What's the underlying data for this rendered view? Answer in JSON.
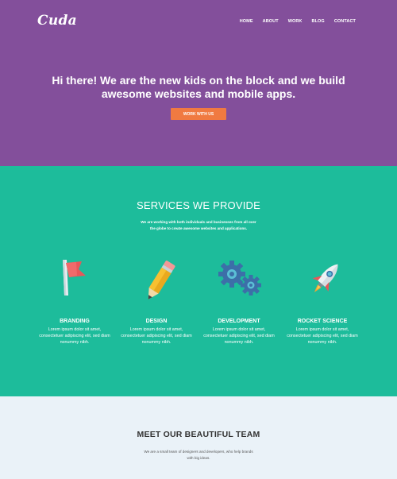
{
  "header": {
    "logo": "Cuda",
    "nav": [
      "HOME",
      "ABOUT",
      "WORK",
      "BLOG",
      "CONTACT"
    ]
  },
  "hero": {
    "headline_line1": "Hi there! We are the new kids on the block and we build",
    "headline_line2": "awesome websites and mobile apps.",
    "cta_label": "WORK WITH US"
  },
  "services": {
    "title": "SERVICES WE PROVIDE",
    "desc_line1": "We are working with both individuals and businesses from all over",
    "desc_line2": "the globe to create awesome websites and applications.",
    "items": [
      {
        "name": "BRANDING",
        "icon": "flag-icon",
        "line1": "Lorem ipsum dolor sit amet,",
        "line2": "consectetuer adipiscing elit, sed diam",
        "line3": "nonummy nibh."
      },
      {
        "name": "DESIGN",
        "icon": "pencil-icon",
        "line1": "Lorem ipsum dolor sit amet,",
        "line2": "consectetuer adipiscing elit, sed diam",
        "line3": "nonummy nibh."
      },
      {
        "name": "DEVELOPMENT",
        "icon": "gears-icon",
        "line1": "Lorem ipsum dolor sit amet,",
        "line2": "consectetuer adipiscing elit, sed diam",
        "line3": "nonummy nibh."
      },
      {
        "name": "ROCKET SCIENCE",
        "icon": "rocket-icon",
        "line1": "Lorem ipsum dolor sit amet,",
        "line2": "consectetuer adipiscing elit, sed diam",
        "line3": "nonummy nibh."
      }
    ]
  },
  "team": {
    "title": "MEET OUR BEAUTIFUL TEAM",
    "desc_line1": "We are a small team of designers and developers, who help brands",
    "desc_line2": "with big ideas."
  },
  "colors": {
    "hero_bg": "#834f9b",
    "cta": "#f07a41",
    "services_bg": "#1dbc9b",
    "team_bg": "#eaf2f8"
  }
}
